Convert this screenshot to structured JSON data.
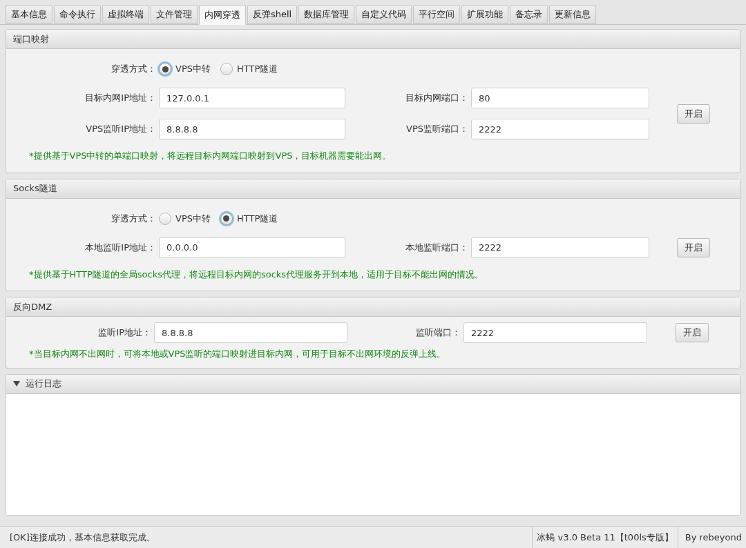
{
  "tabs": [
    {
      "label": "基本信息",
      "selected": false
    },
    {
      "label": "命令执行",
      "selected": false
    },
    {
      "label": "虚拟终端",
      "selected": false
    },
    {
      "label": "文件管理",
      "selected": false
    },
    {
      "label": "内网穿透",
      "selected": true
    },
    {
      "label": "反弹shell",
      "selected": false
    },
    {
      "label": "数据库管理",
      "selected": false
    },
    {
      "label": "自定义代码",
      "selected": false
    },
    {
      "label": "平行空间",
      "selected": false
    },
    {
      "label": "扩展功能",
      "selected": false
    },
    {
      "label": "备忘录",
      "selected": false
    },
    {
      "label": "更新信息",
      "selected": false
    }
  ],
  "port_mapping": {
    "title": "端口映射",
    "mode_label": "穿透方式：",
    "modes": [
      {
        "label": "VPS中转",
        "selected": true
      },
      {
        "label": "HTTP隧道",
        "selected": false
      }
    ],
    "rows": [
      [
        {
          "label": "目标内网IP地址：",
          "value": "127.0.0.1"
        },
        {
          "label": "目标内网端口：",
          "value": "80"
        }
      ],
      [
        {
          "label": "VPS监听IP地址：",
          "value": "8.8.8.8"
        },
        {
          "label": "VPS监听端口：",
          "value": "2222"
        }
      ]
    ],
    "button": "开启",
    "note": "*提供基于VPS中转的单端口映射，将远程目标内网端口映射到VPS，目标机器需要能出网。"
  },
  "socks_tunnel": {
    "title": "Socks隧道",
    "mode_label": "穿透方式：",
    "modes": [
      {
        "label": "VPS中转",
        "selected": false
      },
      {
        "label": "HTTP隧道",
        "selected": true
      }
    ],
    "rows": [
      [
        {
          "label": "本地监听IP地址：",
          "value": "0.0.0.0"
        },
        {
          "label": "本地监听端口：",
          "value": "2222"
        }
      ]
    ],
    "button": "开启",
    "note": "*提供基于HTTP隧道的全局socks代理，将远程目标内网的socks代理服务开到本地，适用于目标不能出网的情况。"
  },
  "reverse_dmz": {
    "title": "反向DMZ",
    "rows": [
      [
        {
          "label": "监听IP地址：",
          "value": "8.8.8.8"
        },
        {
          "label": "监听端口：",
          "value": "2222"
        }
      ]
    ],
    "button": "开启",
    "note": "*当目标内网不出网时，可将本地或VPS监听的端口映射进目标内网，可用于目标不出网环境的反弹上线。"
  },
  "run_log": {
    "title": "运行日志",
    "expanded": true
  },
  "status_bar": {
    "message": "[OK]连接成功，基本信息获取完成。",
    "version": "冰蝎 v3.0 Beta 11【t00ls专版】",
    "author": "By rebeyond"
  }
}
